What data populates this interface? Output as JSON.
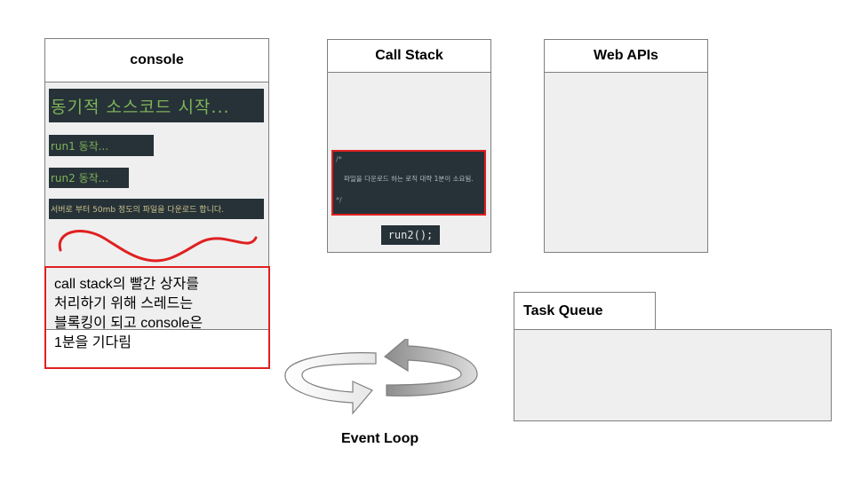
{
  "console": {
    "title": "console",
    "lines": [
      "동기적 소스코드 시작...",
      "run1 동작...",
      "run2 동작...",
      "서버로 부터 50mb 정도의 파일을 다운로드 합니다."
    ]
  },
  "call_stack": {
    "title": "Call Stack",
    "comment_open": "/*",
    "comment_body": "파일을 다운로드 하는 로직 대략 1분이 소요됨.",
    "comment_close": "*/",
    "frame": "run2();"
  },
  "web_apis": {
    "title": "Web APIs"
  },
  "task_queue": {
    "title": "Task Queue"
  },
  "event_loop": {
    "label": "Event Loop"
  },
  "note": {
    "lines": [
      "call stack의 빨간 상자를",
      "처리하기 위해 스레드는",
      "블록킹이 되고 console은",
      "1분을 기다림"
    ]
  },
  "colors": {
    "highlight": "#e02020",
    "code_bg": "#263238",
    "panel_bg": "#efefef"
  }
}
